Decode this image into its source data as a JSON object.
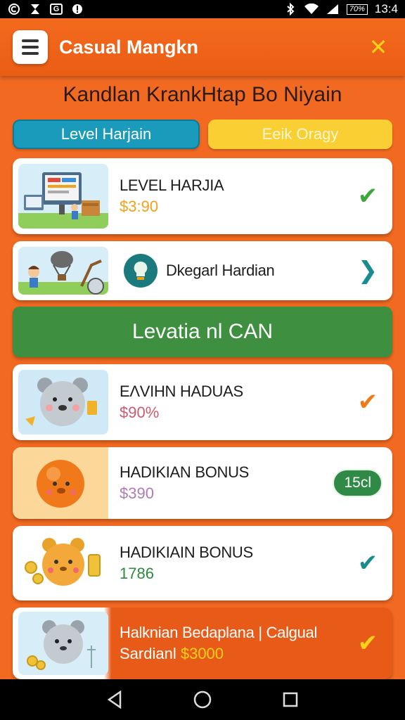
{
  "status_bar": {
    "time": "13:4",
    "battery": "70%",
    "left_icons": [
      "notification-c-icon",
      "app-icon",
      "gallery-icon",
      "message-icon"
    ],
    "right_icons": [
      "bluetooth-icon",
      "wifi-icon",
      "signal-icon"
    ]
  },
  "header": {
    "title": "Casual Mangkn",
    "close_symbol": "✕"
  },
  "page_heading": "Kandlan KrankHtap Bo Niyain",
  "tabs": [
    {
      "label": "Level Harjain"
    },
    {
      "label": "Eeik Oragy"
    }
  ],
  "cards": [
    {
      "title": "LEVEL HARJIA",
      "value": "$3:90",
      "value_color": "#f0a21b",
      "action": "✔",
      "action_color": "#3aa83a"
    },
    {
      "title": "Dkegarl Hardian",
      "value": "",
      "action": "❯",
      "action_color": "#1a8c8f"
    },
    {
      "title": "EΛVIHN HADUAS",
      "value": "$90%",
      "value_color": "#cc5a6e",
      "action": "✔",
      "action_color": "#f07a1a"
    },
    {
      "title": "HADIKIAN BONUS",
      "value": "$390",
      "value_color": "#b07ab8",
      "badge": "15cl"
    },
    {
      "title": "HADIKIAIN BONUS",
      "value": "1786",
      "value_color": "#2e8a3a",
      "action": "✔",
      "action_color": "#1a8c8f"
    },
    {
      "title": "Halknian Bedaplana | Calgual",
      "value_prefix": "Sardianl",
      "value": "$3000",
      "value_color": "#ffd21a",
      "action": "✔",
      "action_color": "#ffd21a"
    }
  ],
  "section_banner": "Levatia nl CAN",
  "colors": {
    "brand_orange": "#f26a22",
    "banner_green": "#3e8f3f",
    "tab_blue": "#1a9bbb",
    "tab_yellow": "#f9cf33"
  }
}
